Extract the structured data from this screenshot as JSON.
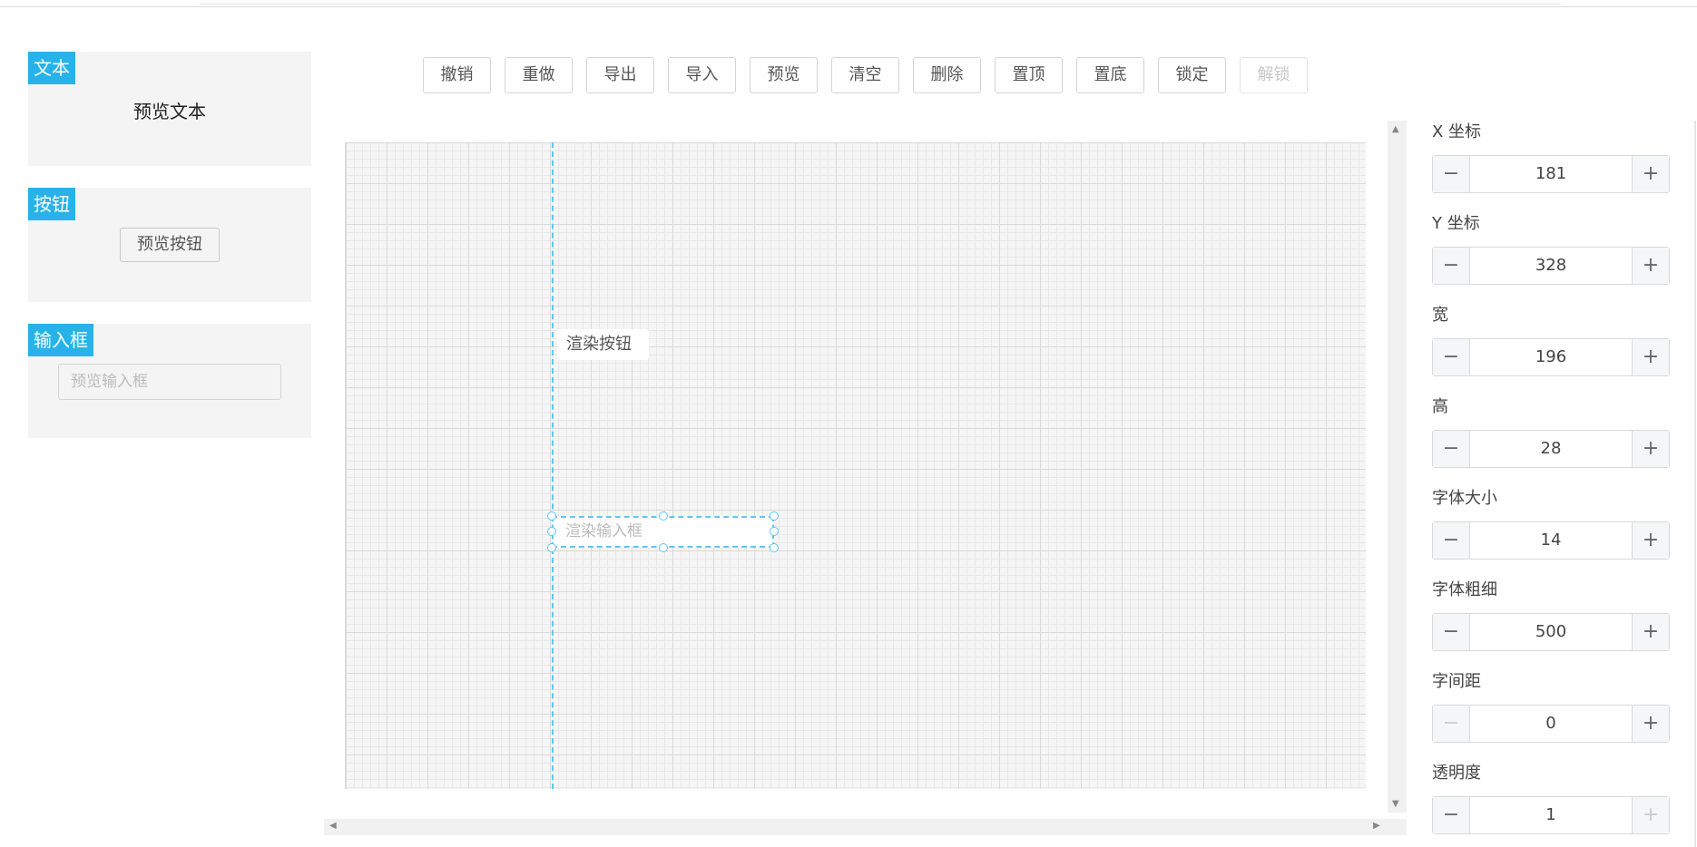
{
  "components": [
    {
      "tag": "文本",
      "preview": "预览文本",
      "kind": "text"
    },
    {
      "tag": "按钮",
      "preview": "预览按钮",
      "kind": "button"
    },
    {
      "tag": "输入框",
      "preview": "预览输入框",
      "kind": "input"
    }
  ],
  "toolbar": {
    "undo": "撤销",
    "redo": "重做",
    "export": "导出",
    "import": "导入",
    "preview": "预览",
    "clear": "清空",
    "delete": "删除",
    "top": "置顶",
    "bottom": "置底",
    "lock": "锁定",
    "unlock": "解锁"
  },
  "canvas": {
    "button_text": "渲染按钮",
    "input_placeholder": "渲染输入框"
  },
  "properties": [
    {
      "label": "X 坐标",
      "value": "181"
    },
    {
      "label": "Y 坐标",
      "value": "328"
    },
    {
      "label": "宽",
      "value": "196"
    },
    {
      "label": "高",
      "value": "28"
    },
    {
      "label": "字体大小",
      "value": "14"
    },
    {
      "label": "字体粗细",
      "value": "500"
    },
    {
      "label": "字间距",
      "value": "0"
    },
    {
      "label": "透明度",
      "value": "1"
    }
  ],
  "colors": {
    "accent": "#27b3e9",
    "guide": "#5ec8f2"
  },
  "icons": {
    "minus": "minus-icon",
    "plus": "plus-icon",
    "scroll_up": "arrow-up-icon",
    "scroll_down": "arrow-down-icon",
    "scroll_left": "arrow-left-icon",
    "scroll_right": "arrow-right-icon"
  }
}
